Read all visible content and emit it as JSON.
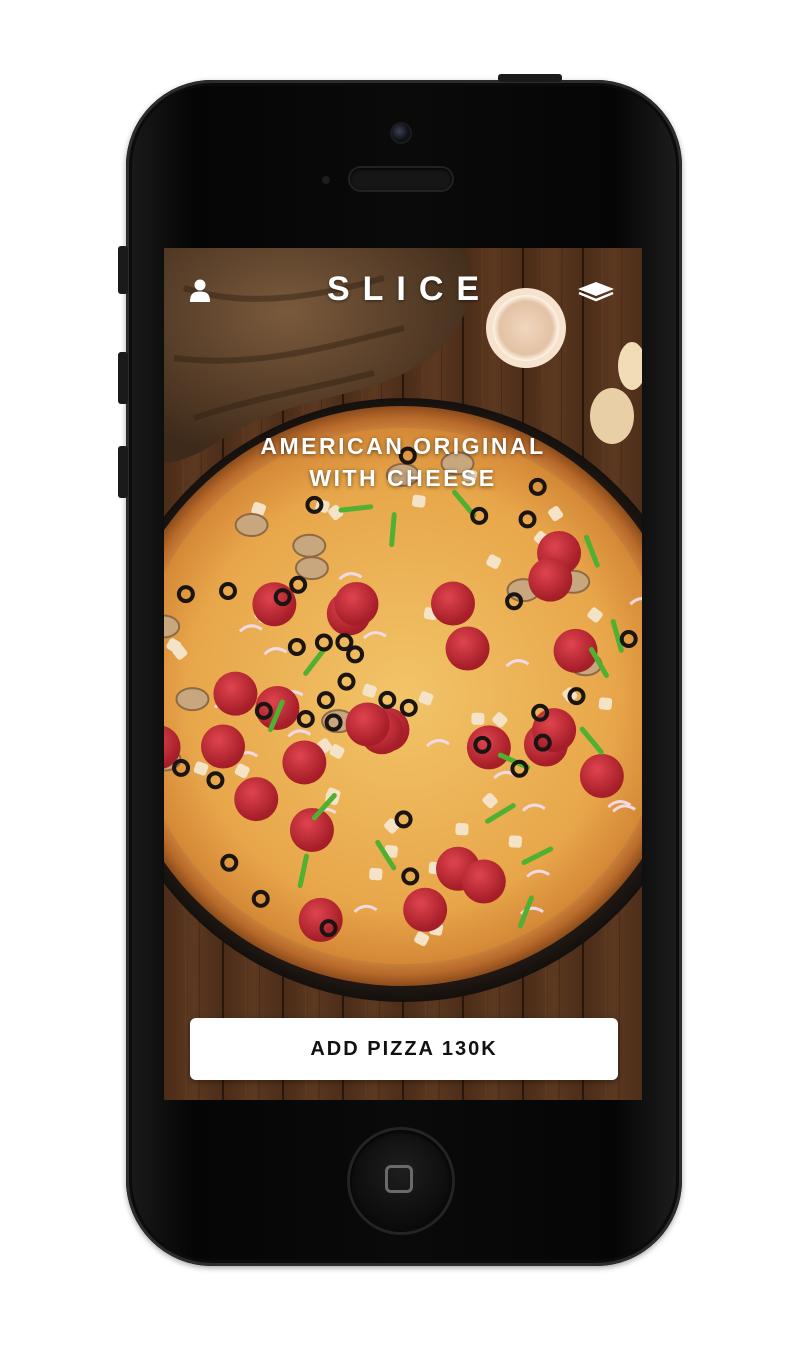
{
  "app": {
    "brand": "SLICE"
  },
  "header": {
    "user_icon": "user-icon",
    "menu_icon": "layers-icon"
  },
  "product": {
    "title_line1": "AMERICAN ORIGINAL",
    "title_line2": "WITH CHEESE",
    "add_button_label": "ADD PIZZA 130K"
  },
  "colors": {
    "text": "#ffffff",
    "button_bg": "#ffffff",
    "button_text": "#111111",
    "phone_body": "#0a0a0a"
  }
}
